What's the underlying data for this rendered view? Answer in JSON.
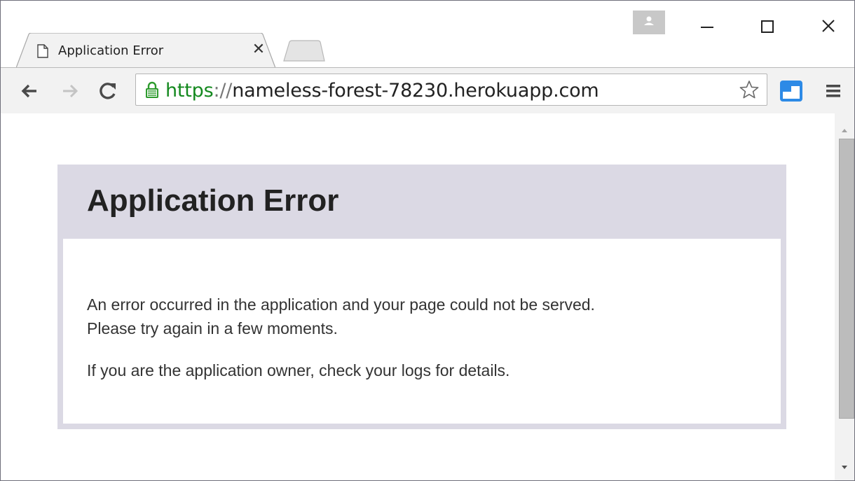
{
  "browser": {
    "tab": {
      "title": "Application Error",
      "close_glyph": "✕",
      "icon": "page-icon"
    },
    "window_controls": [
      "minimize-icon",
      "maximize-icon",
      "close-icon"
    ],
    "address_bar": {
      "scheme": "https",
      "separator": "://",
      "host": "nameless-forest-78230.herokuapp.com",
      "secure": true
    },
    "colors": {
      "secure_scheme": "#14891f",
      "error_frame": "#dbd9e4"
    }
  },
  "page": {
    "heading": "Application Error",
    "paragraph1_line1": "An error occurred in the application and your page could not be served.",
    "paragraph1_line2": "Please try again in a few moments.",
    "paragraph2": "If you are the application owner, check your logs for details."
  }
}
